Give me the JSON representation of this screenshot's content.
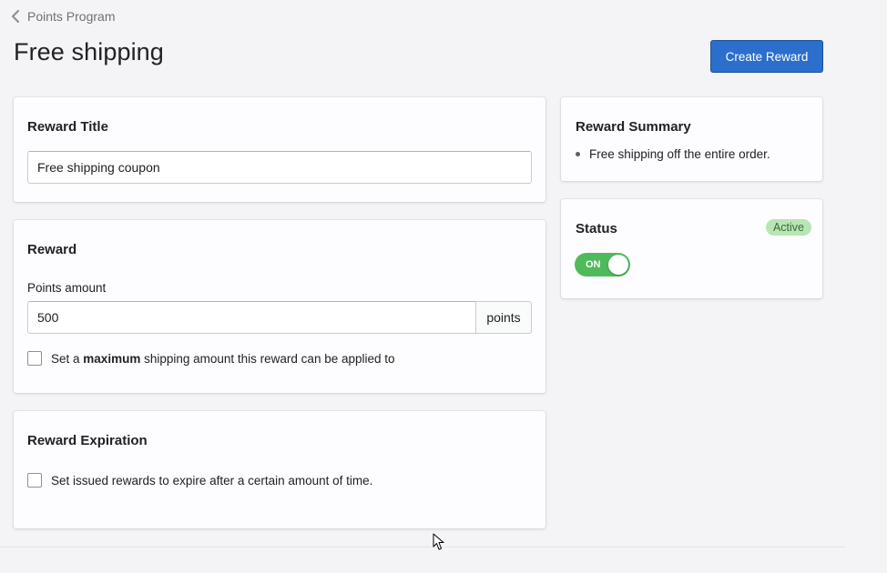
{
  "breadcrumb": {
    "label": "Points Program"
  },
  "page": {
    "title": "Free shipping"
  },
  "actions": {
    "create_label": "Create Reward"
  },
  "reward_title_card": {
    "heading": "Reward Title",
    "input_value": "Free shipping coupon"
  },
  "reward_card": {
    "heading": "Reward",
    "points_label": "Points amount",
    "points_value": "500",
    "points_suffix": "points",
    "max_prefix": "Set a",
    "max_bold": "maximum",
    "max_suffix": "shipping amount this reward can be applied to"
  },
  "expiration_card": {
    "heading": "Reward Expiration",
    "checkbox_label": "Set issued rewards to expire after a certain amount of time."
  },
  "summary_card": {
    "heading": "Reward Summary",
    "items": [
      "Free shipping off the entire order."
    ]
  },
  "status_card": {
    "heading": "Status",
    "badge": "Active",
    "toggle_label": "ON"
  },
  "colors": {
    "primary": "#2c6ecb",
    "toggle_on": "#4fba5b",
    "badge_bg": "#b8e5b5"
  }
}
